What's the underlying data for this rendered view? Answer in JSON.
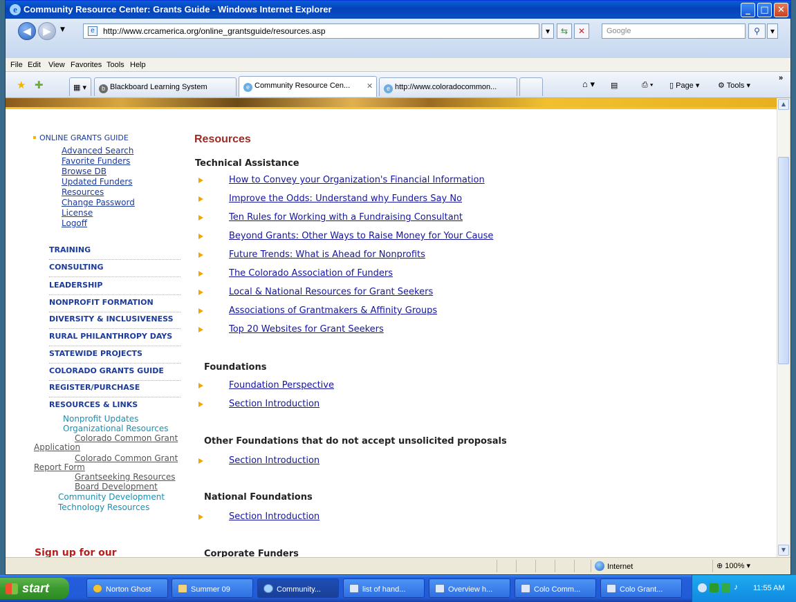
{
  "window": {
    "title": "Community Resource Center: Grants Guide - Windows Internet Explorer"
  },
  "address": {
    "url": "http://www.crcamerica.org/online_grantsguide/resources.asp",
    "search_placeholder": "Google"
  },
  "menu": [
    "File",
    "Edit",
    "View",
    "Favorites",
    "Tools",
    "Help"
  ],
  "tabs": [
    "Blackboard Learning System",
    "Community Resource Cen...",
    "http://www.coloradocommon..."
  ],
  "commandbar": {
    "page": "Page",
    "tools": "Tools"
  },
  "leftnav": {
    "ogg": "ONLINE GRANTS GUIDE",
    "ogg_links": [
      "Advanced Search",
      "Favorite Funders",
      "Browse DB",
      "Updated Funders",
      "Resources",
      "Change Password",
      "License",
      "Logoff"
    ],
    "sections": [
      "TRAINING",
      "CONSULTING",
      "LEADERSHIP",
      "NONPROFIT FORMATION",
      "DIVERSITY & INCLUSIVENESS",
      "RURAL PHILANTHROPY DAYS",
      "STATEWIDE PROJECTS",
      "COLORADO GRANTS GUIDE",
      "REGISTER/PURCHASE",
      "RESOURCES & LINKS"
    ],
    "resources": {
      "nonprofit_updates": "Nonprofit Updates",
      "org_resources": "Organizational Resources",
      "ccg_app_1": "Colorado Common Grant",
      "ccg_app_2": "Application",
      "ccg_rep_1": "Colorado Common Grant",
      "ccg_rep_2": "Report Form",
      "grantseeking": "Grantseeking Resources",
      "board": "Board Development",
      "community": "Community Development",
      "technology": "Technology Resources"
    },
    "signup": "Sign up for our"
  },
  "main": {
    "heading": "Resources",
    "sections": [
      {
        "title": "Technical Assistance",
        "links": [
          "How to Convey your Organization's Financial Information",
          "Improve the Odds: Understand why Funders Say No",
          "Ten Rules for Working with a Fundraising Consultant",
          "Beyond Grants: Other Ways to Raise Money for Your Cause",
          "Future Trends: What is Ahead for Nonprofits",
          "The Colorado Association of Funders",
          "Local & National Resources for Grant Seekers",
          "Associations of Grantmakers & Affinity Groups",
          "Top 20 Websites for Grant Seekers"
        ]
      },
      {
        "title": "Foundations",
        "links": [
          "Foundation Perspective",
          "Section Introduction"
        ]
      },
      {
        "title": "Other Foundations that do not accept unsolicited proposals",
        "links": [
          "Section Introduction"
        ]
      },
      {
        "title": "National Foundations",
        "links": [
          "Section Introduction"
        ]
      },
      {
        "title": "Corporate Funders",
        "links": []
      }
    ]
  },
  "status": {
    "zone": "Internet",
    "zoom": "100%"
  },
  "taskbar": {
    "start": "start",
    "items": [
      "Norton Ghost",
      "Summer 09",
      "Community...",
      "list of hand...",
      "Overview h...",
      "Colo Comm...",
      "Colo Grant..."
    ],
    "clock": "11:55 AM"
  }
}
